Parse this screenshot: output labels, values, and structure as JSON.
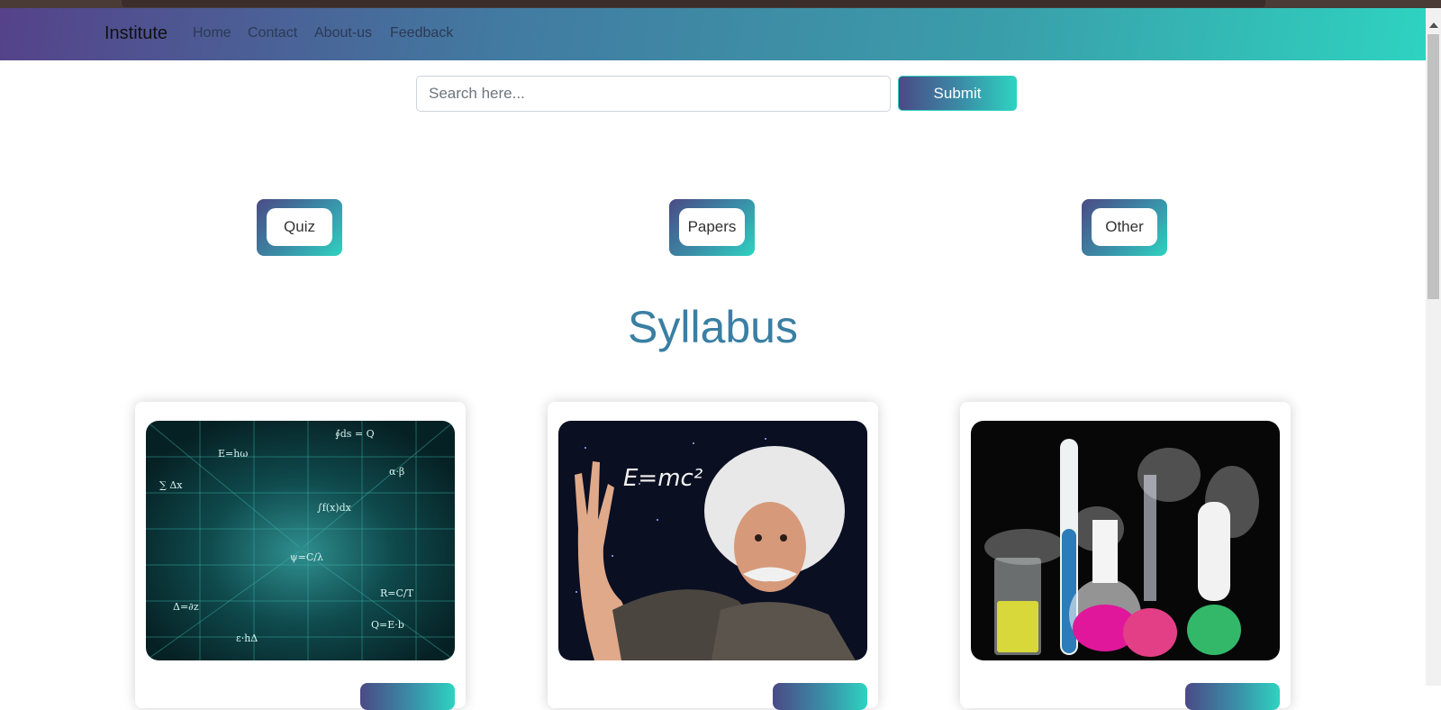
{
  "navbar": {
    "brand": "Institute",
    "links": [
      "Home",
      "Contact",
      "About-us",
      "Feedback"
    ]
  },
  "search": {
    "placeholder": "Search here...",
    "submit_label": "Submit"
  },
  "categories": [
    "Quiz",
    "Papers",
    "Other"
  ],
  "section_title": "Syllabus",
  "cards": [
    {
      "image": "math-equations-image"
    },
    {
      "image": "einstein-physics-image"
    },
    {
      "image": "chemistry-flasks-image"
    }
  ],
  "colors": {
    "brand_gradient_start": "#55428a",
    "brand_gradient_end": "#2ed3c0",
    "heading": "#3a7fa3"
  }
}
